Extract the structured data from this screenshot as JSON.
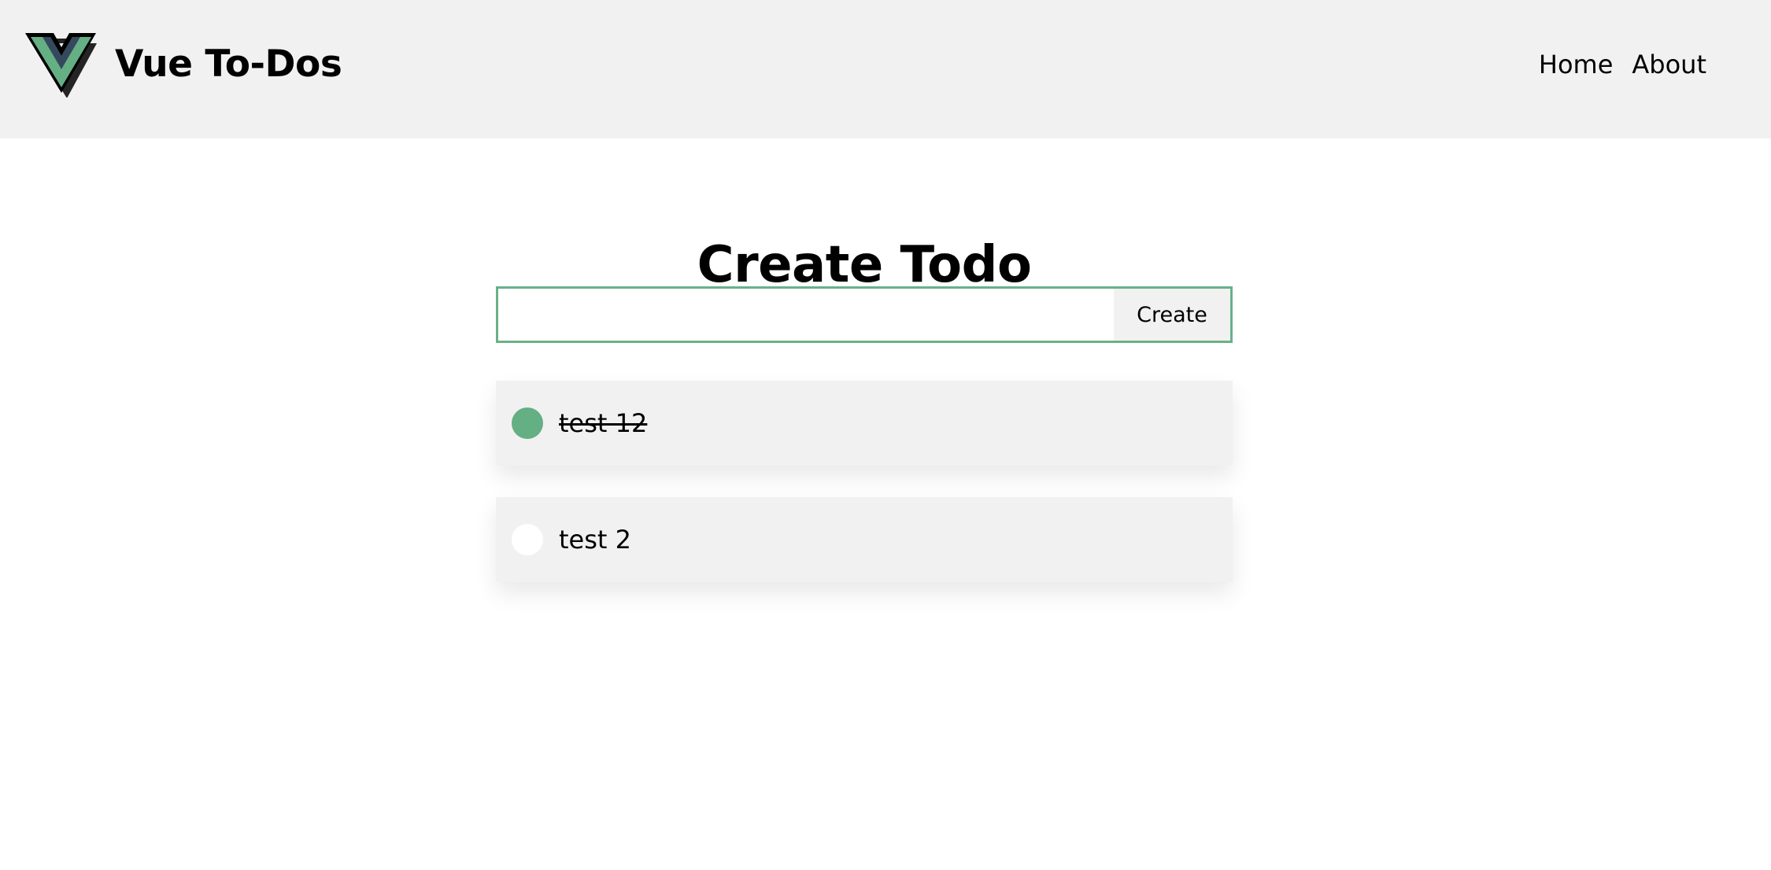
{
  "header": {
    "brand": "Vue To-Dos",
    "logo_icon": "vue-logo-icon",
    "nav": [
      {
        "label": "Home"
      },
      {
        "label": "About"
      }
    ]
  },
  "main": {
    "title": "Create Todo",
    "create": {
      "input_value": "",
      "button_label": "Create"
    },
    "todos": [
      {
        "text": "test 12",
        "completed": true
      },
      {
        "text": "test 2",
        "completed": false
      }
    ]
  },
  "colors": {
    "accent": "#64af84",
    "header_bg": "#f1f1f1",
    "item_bg": "#f1f1f1",
    "logo_dark": "#35495e"
  }
}
